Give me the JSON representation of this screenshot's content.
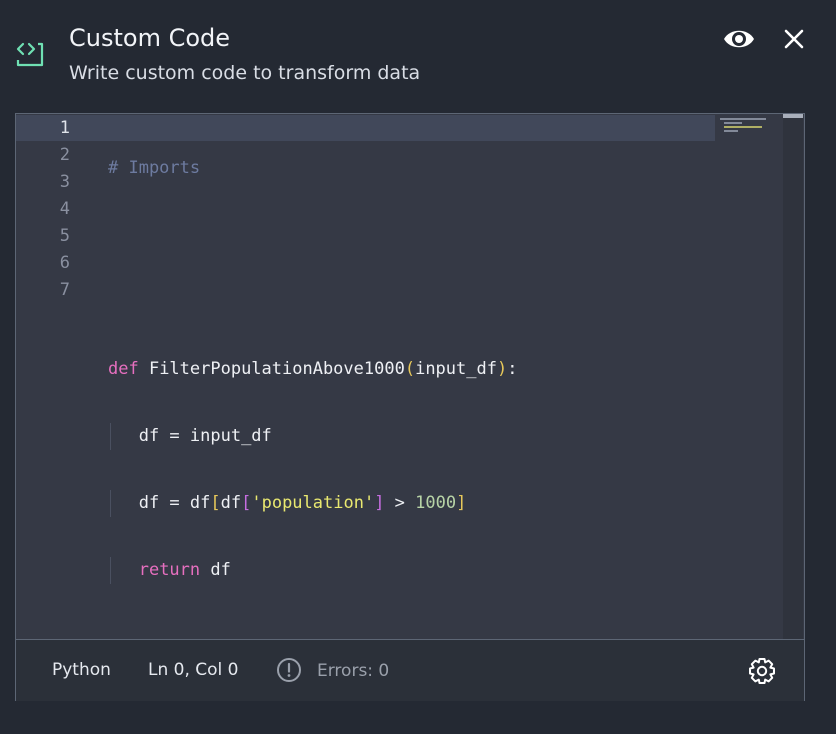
{
  "header": {
    "title": "Custom Code",
    "subtitle": "Write custom code to transform data",
    "icons": {
      "brand": "code-brackets-icon",
      "preview": "eye-icon",
      "close": "close-icon"
    },
    "accent_color": "#6fe0b3"
  },
  "editor": {
    "line_numbers": [
      "1",
      "2",
      "3",
      "4",
      "5",
      "6",
      "7"
    ],
    "active_line": 1,
    "code": {
      "line1": {
        "comment": "# Imports"
      },
      "line4": {
        "kw": "def",
        "name": " FilterPopulationAbove1000",
        "open": "(",
        "arg": "input_df",
        "close": ")",
        "colon": ":"
      },
      "line5": {
        "text": "df = input_df"
      },
      "line6": {
        "a": "df = df",
        "b1": "[",
        "c": "df",
        "b2": "[",
        "str": "'population'",
        "b3": "]",
        "op": " > ",
        "num": "1000",
        "b4": "]"
      },
      "line7": {
        "kw": "return",
        "rest": " df"
      }
    }
  },
  "status_bar": {
    "language": "Python",
    "position": "Ln 0, Col 0",
    "errors": "Errors: 0",
    "icons": {
      "error": "alert-circle-icon",
      "settings": "gear-icon"
    }
  },
  "colors": {
    "background": "#242933",
    "editor_background": "#353945",
    "keyword": "#e66fbf",
    "comment": "#6d7ba0",
    "string": "#e9e870",
    "number": "#b7d3a6"
  }
}
